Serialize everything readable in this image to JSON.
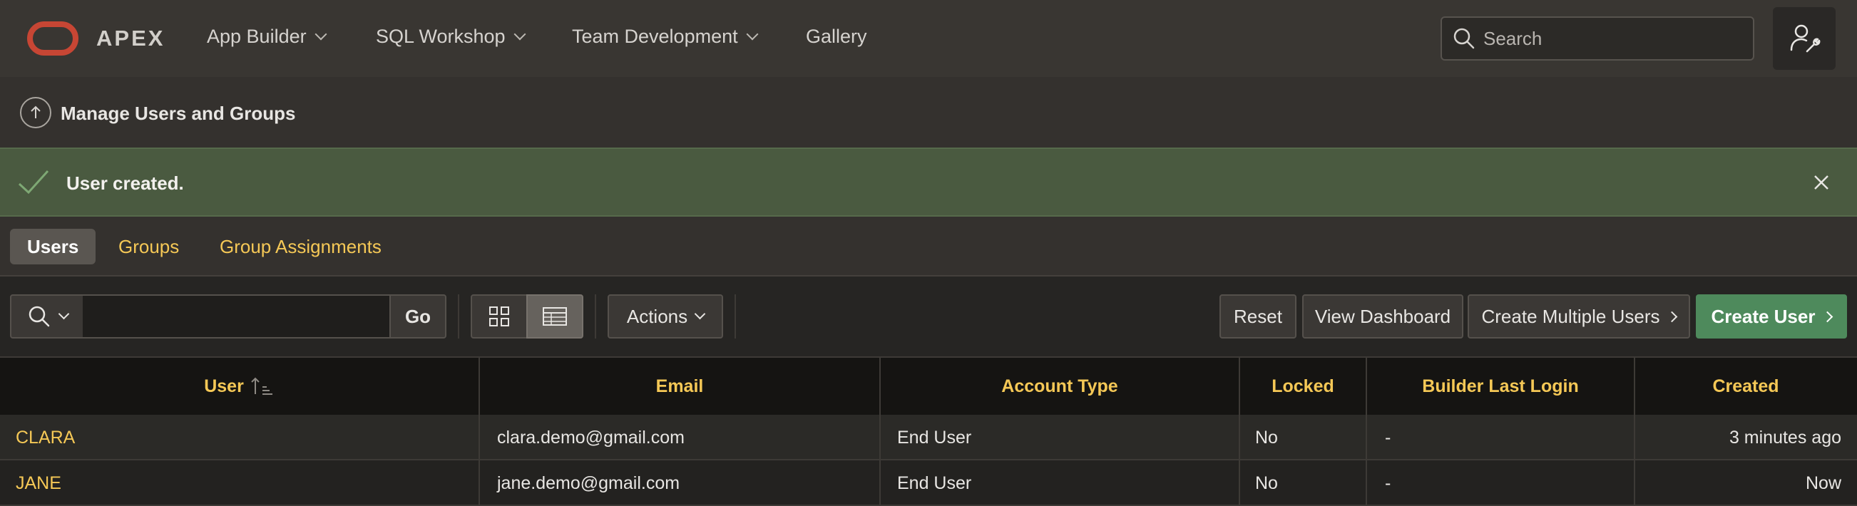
{
  "header": {
    "brand": "APEX",
    "nav": [
      {
        "label": "App Builder",
        "has_menu": true
      },
      {
        "label": "SQL Workshop",
        "has_menu": true
      },
      {
        "label": "Team Development",
        "has_menu": true
      },
      {
        "label": "Gallery",
        "has_menu": false
      }
    ],
    "search_placeholder": "Search",
    "brand_color": "#c74634"
  },
  "breadcrumb": {
    "title": "Manage Users and Groups"
  },
  "alert": {
    "message": "User created.",
    "type": "success"
  },
  "tabs": [
    {
      "label": "Users",
      "active": true
    },
    {
      "label": "Groups",
      "active": false
    },
    {
      "label": "Group Assignments",
      "active": false
    }
  ],
  "toolbar": {
    "go_label": "Go",
    "search_value": "",
    "actions_label": "Actions",
    "reset_label": "Reset",
    "view_dashboard_label": "View Dashboard",
    "create_multiple_label": "Create Multiple Users",
    "create_user_label": "Create User",
    "view_mode": "report"
  },
  "table": {
    "columns": [
      "User",
      "Email",
      "Account Type",
      "Locked",
      "Builder Last Login",
      "Created"
    ],
    "sort": {
      "column": "User",
      "direction": "ascending"
    },
    "rows": [
      {
        "user": "CLARA",
        "email": "clara.demo@gmail.com",
        "account_type": "End User",
        "locked": "No",
        "builder_last_login": "-",
        "created": "3 minutes ago"
      },
      {
        "user": "JANE",
        "email": "jane.demo@gmail.com",
        "account_type": "End User",
        "locked": "No",
        "builder_last_login": "-",
        "created": "Now"
      }
    ]
  },
  "colors": {
    "accent_link": "#f5c856",
    "primary_button": "#4e8a5c",
    "success_banner": "#4a5a40"
  }
}
